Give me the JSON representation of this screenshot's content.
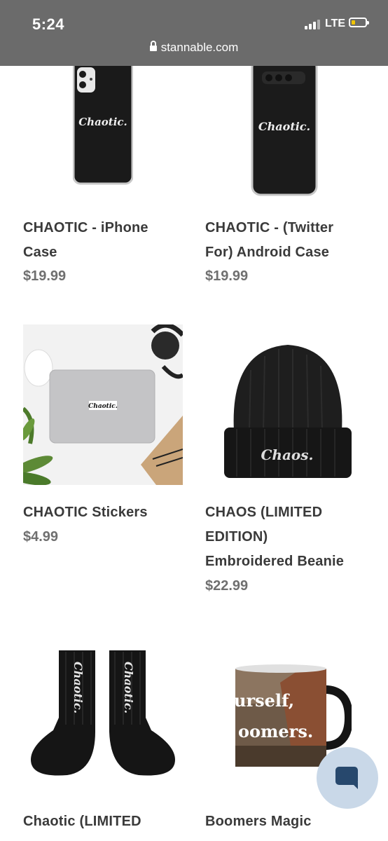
{
  "status_bar": {
    "time": "5:24",
    "network": "LTE"
  },
  "browser": {
    "url": "stannable.com"
  },
  "products": [
    {
      "title_line1": "CHAOTIC - iPhone",
      "title_line2": "Case",
      "price": "$19.99",
      "image_text": "Chaotic."
    },
    {
      "title_line1": "CHAOTIC - (Twitter",
      "title_line2": "For) Android Case",
      "price": "$19.99",
      "image_text": "Chaotic."
    },
    {
      "title_line1": "CHAOTIC Stickers",
      "price": "$4.99",
      "image_text": "Chaotic."
    },
    {
      "title_line1": "CHAOS (LIMITED",
      "title_line2": "EDITION)",
      "title_line3": "Embroidered Beanie",
      "price": "$22.99",
      "image_text": "Chaos."
    },
    {
      "title_line1": "Chaotic (LIMITED",
      "image_text": "Chaotic."
    },
    {
      "title_line1": "Boomers Magic",
      "image_text_line1": "urself,",
      "image_text_line2": "oomers."
    }
  ],
  "chat": {
    "icon": "chat-bubble-icon"
  }
}
